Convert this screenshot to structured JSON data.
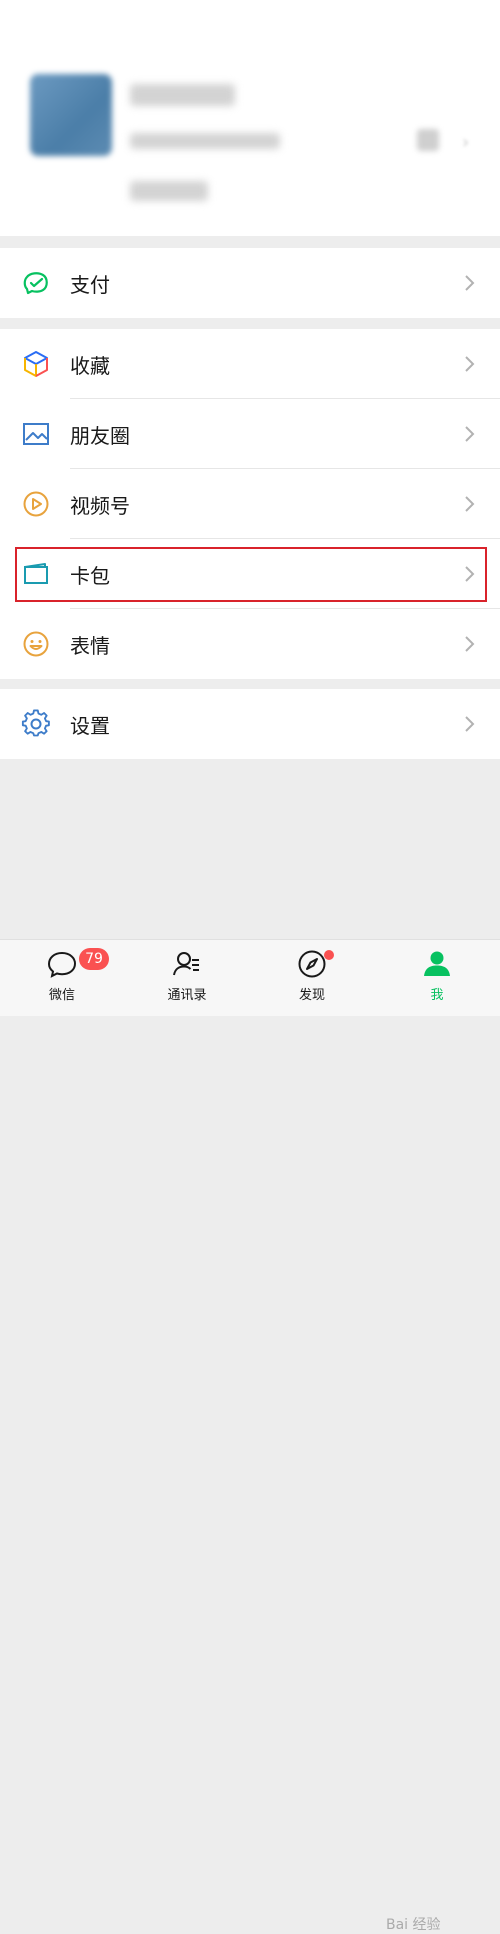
{
  "menu": {
    "pay": "支付",
    "favorites": "收藏",
    "moments": "朋友圈",
    "channels": "视频号",
    "cards": "卡包",
    "stickers": "表情",
    "settings": "设置"
  },
  "tabbar": {
    "chats": "微信",
    "chats_badge": "79",
    "contacts": "通讯录",
    "discover": "发现",
    "me": "我"
  },
  "watermark": "Bai 经验",
  "colors": {
    "accent": "#07c160",
    "badge": "#fa5151",
    "highlight": "#d9232b"
  }
}
